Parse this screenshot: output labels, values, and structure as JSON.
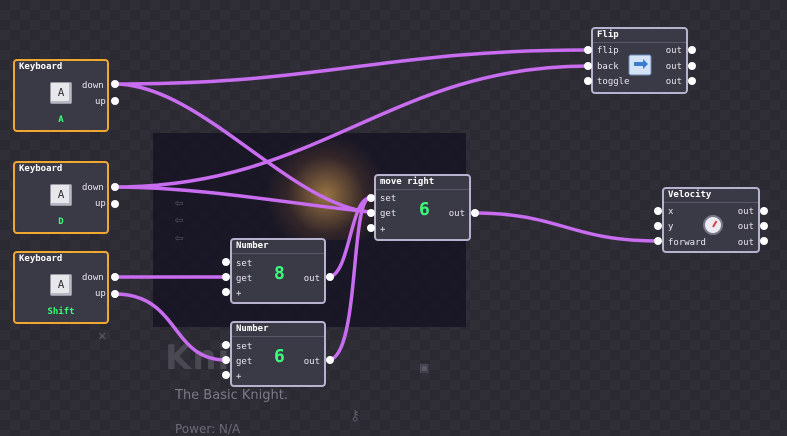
{
  "background": {
    "title": "Kni",
    "subtitle": "The Basic Knight.",
    "power": "Power: N/A"
  },
  "keyboard_nodes": [
    {
      "title": "Keyboard",
      "key": "A",
      "key_name": "A",
      "outputs": [
        "down",
        "up"
      ]
    },
    {
      "title": "Keyboard",
      "key": "A",
      "key_name": "D",
      "outputs": [
        "down",
        "up"
      ]
    },
    {
      "title": "Keyboard",
      "key": "A",
      "key_name": "Shift",
      "outputs": [
        "down",
        "up"
      ]
    }
  ],
  "flip_node": {
    "title": "Flip",
    "inputs": [
      "flip",
      "back",
      "toggle"
    ],
    "outputs": [
      "out",
      "out",
      "out"
    ],
    "icon": "flip-arrows-icon"
  },
  "move_right_node": {
    "title": "move right",
    "value": "6",
    "inputs": [
      "set",
      "get",
      "+"
    ],
    "output": "out"
  },
  "number_nodes": [
    {
      "title": "Number",
      "value": "8",
      "inputs": [
        "set",
        "get",
        "+"
      ],
      "output": "out"
    },
    {
      "title": "Number",
      "value": "6",
      "inputs": [
        "set",
        "get",
        "+"
      ],
      "output": "out"
    }
  ],
  "velocity_node": {
    "title": "Velocity",
    "inputs": [
      "x",
      "y",
      "forward"
    ],
    "outputs": [
      "out",
      "out",
      "out"
    ],
    "icon": "speedometer-icon"
  },
  "colors": {
    "wire": "#c86cf0",
    "key_border": "#f0a830",
    "node_border": "#b7b3cf",
    "value_text": "#3aff7a"
  }
}
